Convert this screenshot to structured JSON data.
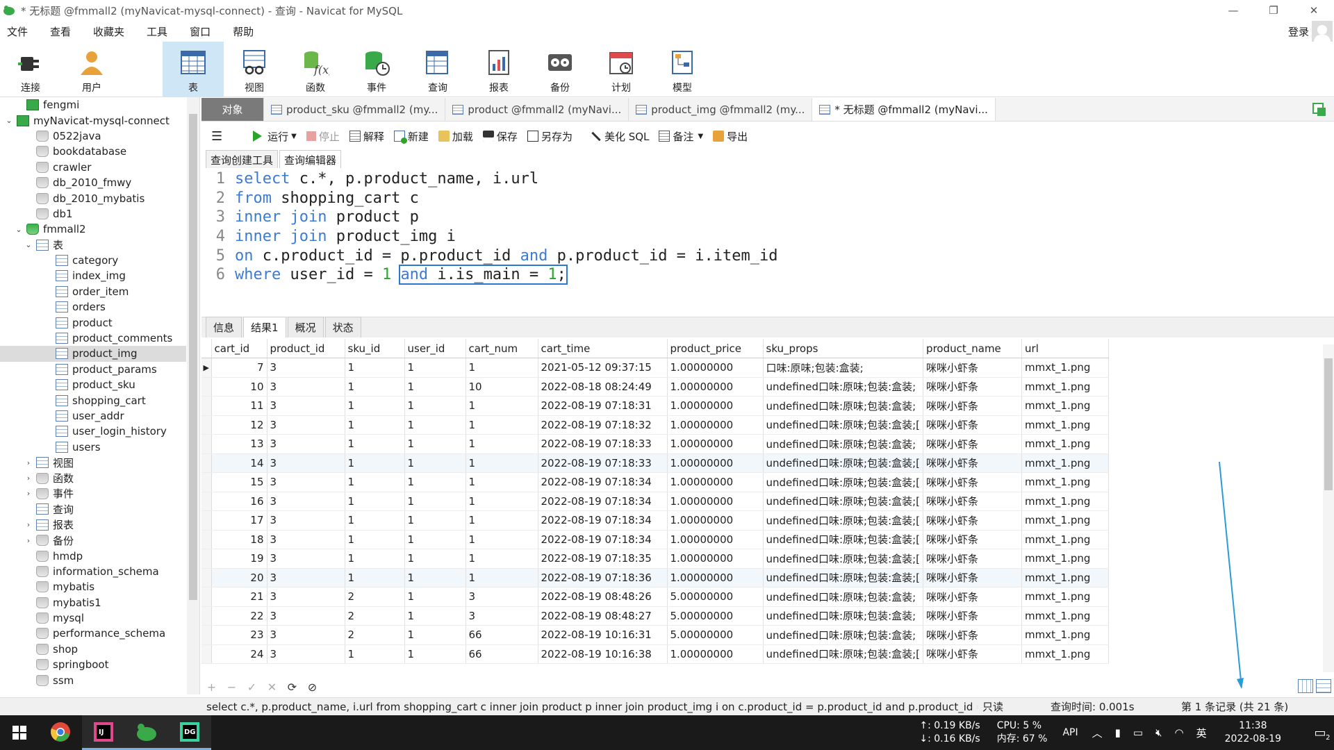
{
  "window": {
    "title": "* 无标题 @fmmall2 (myNavicat-mysql-connect) - 查询 - Navicat for MySQL",
    "minimize": "—",
    "restore": "❐",
    "close": "✕"
  },
  "menu": {
    "items": [
      "文件",
      "查看",
      "收藏夹",
      "工具",
      "窗口",
      "帮助"
    ],
    "login": "登录"
  },
  "ribbon": {
    "items": [
      {
        "label": "连接",
        "icon": "plug-icon"
      },
      {
        "label": "用户",
        "icon": "user-icon"
      },
      {
        "label": "表",
        "icon": "table-icon"
      },
      {
        "label": "视图",
        "icon": "view-icon"
      },
      {
        "label": "函数",
        "icon": "function-icon"
      },
      {
        "label": "事件",
        "icon": "event-icon"
      },
      {
        "label": "查询",
        "icon": "query-icon"
      },
      {
        "label": "报表",
        "icon": "report-icon"
      },
      {
        "label": "备份",
        "icon": "backup-icon"
      },
      {
        "label": "计划",
        "icon": "schedule-icon"
      },
      {
        "label": "模型",
        "icon": "model-icon"
      }
    ]
  },
  "sidebar": {
    "nodes": [
      {
        "label": "fengmi",
        "depth": 1,
        "icon": "connection",
        "arrow": ""
      },
      {
        "label": "myNavicat-mysql-connect",
        "depth": 0,
        "icon": "connection",
        "arrow": "⌄"
      },
      {
        "label": "0522java",
        "depth": 2,
        "icon": "db",
        "arrow": ""
      },
      {
        "label": "bookdatabase",
        "depth": 2,
        "icon": "db",
        "arrow": ""
      },
      {
        "label": "crawler",
        "depth": 2,
        "icon": "db",
        "arrow": ""
      },
      {
        "label": "db_2010_fmwy",
        "depth": 2,
        "icon": "db",
        "arrow": ""
      },
      {
        "label": "db_2010_mybatis",
        "depth": 2,
        "icon": "db",
        "arrow": ""
      },
      {
        "label": "db1",
        "depth": 2,
        "icon": "db",
        "arrow": ""
      },
      {
        "label": "fmmall2",
        "depth": 1,
        "icon": "db-open",
        "arrow": "⌄"
      },
      {
        "label": "表",
        "depth": 2,
        "icon": "table",
        "arrow": "⌄"
      },
      {
        "label": "category",
        "depth": 4,
        "icon": "table",
        "arrow": ""
      },
      {
        "label": "index_img",
        "depth": 4,
        "icon": "table",
        "arrow": ""
      },
      {
        "label": "order_item",
        "depth": 4,
        "icon": "table",
        "arrow": ""
      },
      {
        "label": "orders",
        "depth": 4,
        "icon": "table",
        "arrow": ""
      },
      {
        "label": "product",
        "depth": 4,
        "icon": "table",
        "arrow": ""
      },
      {
        "label": "product_comments",
        "depth": 4,
        "icon": "table",
        "arrow": ""
      },
      {
        "label": "product_img",
        "depth": 4,
        "icon": "table",
        "arrow": "",
        "selected": true
      },
      {
        "label": "product_params",
        "depth": 4,
        "icon": "table",
        "arrow": ""
      },
      {
        "label": "product_sku",
        "depth": 4,
        "icon": "table",
        "arrow": ""
      },
      {
        "label": "shopping_cart",
        "depth": 4,
        "icon": "table",
        "arrow": ""
      },
      {
        "label": "user_addr",
        "depth": 4,
        "icon": "table",
        "arrow": ""
      },
      {
        "label": "user_login_history",
        "depth": 4,
        "icon": "table",
        "arrow": ""
      },
      {
        "label": "users",
        "depth": 4,
        "icon": "table",
        "arrow": ""
      },
      {
        "label": "视图",
        "depth": 2,
        "icon": "view",
        "arrow": "›"
      },
      {
        "label": "函数",
        "depth": 2,
        "icon": "function",
        "arrow": "›"
      },
      {
        "label": "事件",
        "depth": 2,
        "icon": "event",
        "arrow": "›"
      },
      {
        "label": "查询",
        "depth": 2,
        "icon": "query",
        "arrow": ""
      },
      {
        "label": "报表",
        "depth": 2,
        "icon": "report",
        "arrow": "›"
      },
      {
        "label": "备份",
        "depth": 2,
        "icon": "backup",
        "arrow": "›"
      },
      {
        "label": "hmdp",
        "depth": 2,
        "icon": "db",
        "arrow": ""
      },
      {
        "label": "information_schema",
        "depth": 2,
        "icon": "db",
        "arrow": ""
      },
      {
        "label": "mybatis",
        "depth": 2,
        "icon": "db",
        "arrow": ""
      },
      {
        "label": "mybatis1",
        "depth": 2,
        "icon": "db",
        "arrow": ""
      },
      {
        "label": "mysql",
        "depth": 2,
        "icon": "db",
        "arrow": ""
      },
      {
        "label": "performance_schema",
        "depth": 2,
        "icon": "db",
        "arrow": ""
      },
      {
        "label": "shop",
        "depth": 2,
        "icon": "db",
        "arrow": ""
      },
      {
        "label": "springboot",
        "depth": 2,
        "icon": "db",
        "arrow": ""
      },
      {
        "label": "ssm",
        "depth": 2,
        "icon": "db",
        "arrow": ""
      }
    ]
  },
  "tabs": {
    "object": "对象",
    "items": [
      {
        "label": "product_sku @fmmall2 (my...",
        "active": false
      },
      {
        "label": "product @fmmall2 (myNavi...",
        "active": false
      },
      {
        "label": "product_img @fmmall2 (my...",
        "active": false
      },
      {
        "label": "* 无标题 @fmmall2 (myNavi...",
        "active": true
      }
    ]
  },
  "query_toolbar": {
    "menu": "☰",
    "run": "运行",
    "stop": "停止",
    "explain": "解释",
    "new": "新建",
    "load": "加载",
    "save": "保存",
    "save_as": "另存为",
    "beautify": "美化 SQL",
    "comment": "备注",
    "export": "导出"
  },
  "subtabs": {
    "builder": "查询创建工具",
    "editor": "查询编辑器"
  },
  "editor": {
    "lines": [
      [
        {
          "t": "select",
          "c": "kw"
        },
        {
          "t": " c.*, p.product_name, i.url",
          "c": ""
        }
      ],
      [
        {
          "t": "from",
          "c": "kw"
        },
        {
          "t": " shopping_cart c",
          "c": ""
        }
      ],
      [
        {
          "t": "inner join",
          "c": "kw"
        },
        {
          "t": " product p",
          "c": ""
        }
      ],
      [
        {
          "t": "inner join",
          "c": "kw"
        },
        {
          "t": " product_img i",
          "c": ""
        }
      ],
      [
        {
          "t": "on",
          "c": "kw"
        },
        {
          "t": " c.product_id = p.product_id ",
          "c": ""
        },
        {
          "t": "and",
          "c": "kw"
        },
        {
          "t": " p.product_id = i.item_id",
          "c": ""
        }
      ],
      [
        {
          "t": "where",
          "c": "kw"
        },
        {
          "t": " user_id = ",
          "c": ""
        },
        {
          "t": "1",
          "c": "num"
        },
        {
          "t": " ",
          "c": ""
        },
        {
          "t": "and i.is_main = 1;",
          "c": "hl"
        }
      ]
    ]
  },
  "result_tabs": {
    "info": "信息",
    "result1": "结果1",
    "profile": "概况",
    "status": "状态"
  },
  "grid": {
    "columns": [
      "cart_id",
      "product_id",
      "sku_id",
      "user_id",
      "cart_num",
      "cart_time",
      "product_price",
      "sku_props",
      "product_name",
      "url"
    ],
    "rows": [
      [
        "7",
        "3",
        "1",
        "1",
        "1",
        "2021-05-12 09:37:15",
        "1.00000000",
        "口味:原味;包装:盒装;",
        "咪咪小虾条",
        "mmxt_1.png"
      ],
      [
        "10",
        "3",
        "1",
        "1",
        "10",
        "2022-08-18 08:24:49",
        "1.00000000",
        "undefined口味:原味;包装:盒装;",
        "咪咪小虾条",
        "mmxt_1.png"
      ],
      [
        "11",
        "3",
        "1",
        "1",
        "1",
        "2022-08-19 07:18:31",
        "1.00000000",
        "undefined口味:原味;包装:盒装;",
        "咪咪小虾条",
        "mmxt_1.png"
      ],
      [
        "12",
        "3",
        "1",
        "1",
        "1",
        "2022-08-19 07:18:32",
        "1.00000000",
        "undefined口味:原味;包装:盒装;[",
        "咪咪小虾条",
        "mmxt_1.png"
      ],
      [
        "13",
        "3",
        "1",
        "1",
        "1",
        "2022-08-19 07:18:33",
        "1.00000000",
        "undefined口味:原味;包装:盒装;",
        "咪咪小虾条",
        "mmxt_1.png"
      ],
      [
        "14",
        "3",
        "1",
        "1",
        "1",
        "2022-08-19 07:18:33",
        "1.00000000",
        "undefined口味:原味;包装:盒装;[",
        "咪咪小虾条",
        "mmxt_1.png"
      ],
      [
        "15",
        "3",
        "1",
        "1",
        "1",
        "2022-08-19 07:18:34",
        "1.00000000",
        "undefined口味:原味;包装:盒装;[",
        "咪咪小虾条",
        "mmxt_1.png"
      ],
      [
        "16",
        "3",
        "1",
        "1",
        "1",
        "2022-08-19 07:18:34",
        "1.00000000",
        "undefined口味:原味;包装:盒装;[",
        "咪咪小虾条",
        "mmxt_1.png"
      ],
      [
        "17",
        "3",
        "1",
        "1",
        "1",
        "2022-08-19 07:18:34",
        "1.00000000",
        "undefined口味:原味;包装:盒装;[",
        "咪咪小虾条",
        "mmxt_1.png"
      ],
      [
        "18",
        "3",
        "1",
        "1",
        "1",
        "2022-08-19 07:18:34",
        "1.00000000",
        "undefined口味:原味;包装:盒装;[",
        "咪咪小虾条",
        "mmxt_1.png"
      ],
      [
        "19",
        "3",
        "1",
        "1",
        "1",
        "2022-08-19 07:18:35",
        "1.00000000",
        "undefined口味:原味;包装:盒装;[",
        "咪咪小虾条",
        "mmxt_1.png"
      ],
      [
        "20",
        "3",
        "1",
        "1",
        "1",
        "2022-08-19 07:18:36",
        "1.00000000",
        "undefined口味:原味;包装:盒装;[",
        "咪咪小虾条",
        "mmxt_1.png"
      ],
      [
        "21",
        "3",
        "2",
        "1",
        "3",
        "2022-08-19 08:48:26",
        "5.00000000",
        "undefined口味:原味;包装:盒装;",
        "咪咪小虾条",
        "mmxt_1.png"
      ],
      [
        "22",
        "3",
        "2",
        "1",
        "3",
        "2022-08-19 08:48:27",
        "5.00000000",
        "undefined口味:原味;包装:盒装;",
        "咪咪小虾条",
        "mmxt_1.png"
      ],
      [
        "23",
        "3",
        "2",
        "1",
        "66",
        "2022-08-19 10:16:31",
        "5.00000000",
        "undefined口味:原味;包装:盒装;",
        "咪咪小虾条",
        "mmxt_1.png"
      ],
      [
        "24",
        "3",
        "1",
        "1",
        "66",
        "2022-08-19 10:16:38",
        "1.00000000",
        "undefined口味:原味;包装:盒装;[",
        "咪咪小虾条",
        "mmxt_1.png"
      ]
    ],
    "highlight_rows": [
      5,
      11
    ]
  },
  "gridbar": {
    "add": "+",
    "remove": "−",
    "apply": "✓",
    "discard": "✕",
    "refresh": "⟳",
    "stop": "⊘"
  },
  "status": {
    "sql": "select c.*, p.product_name, i.url from shopping_cart c inner join product p inner join product_img i on c.product_id = p.product_id and p.product_id = i.i",
    "readonly": "只读",
    "query_time": "查询时间: 0.001s",
    "record": "第 1 条记录 (共 21 条)"
  },
  "taskbar": {
    "net_up": "↑: 0.19 KB/s",
    "net_down": "↓: 0.16 KB/s",
    "cpu": "CPU: 5 %",
    "mem": "内存: 67 %",
    "api": "API",
    "ime": "英",
    "time": "11:38",
    "date": "2022-08-19",
    "notif_count": "2"
  }
}
